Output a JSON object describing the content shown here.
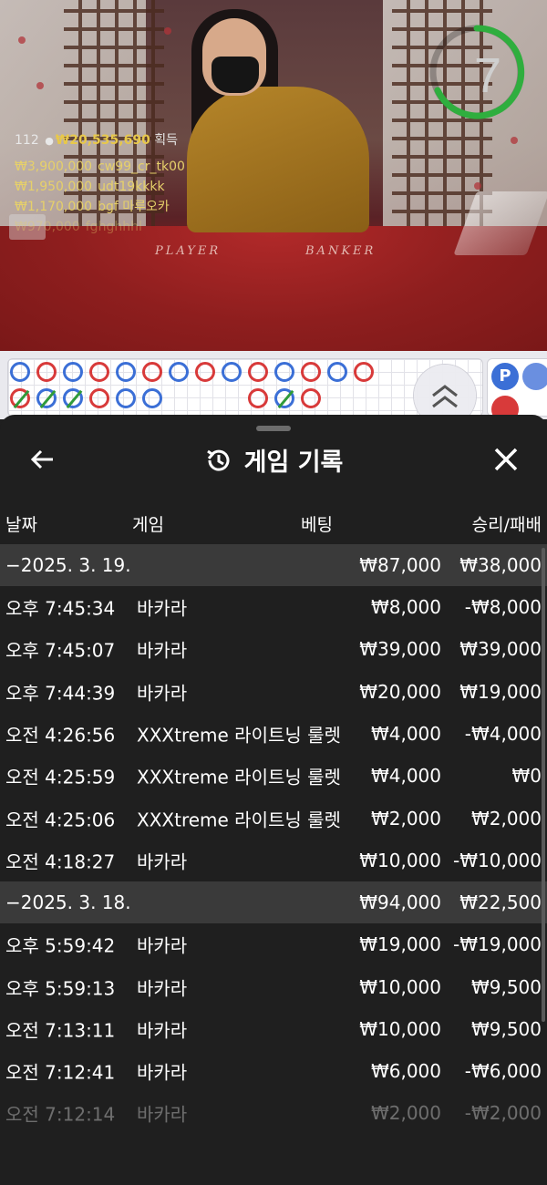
{
  "video": {
    "timer": "7",
    "felt_left": "PLAYER",
    "felt_right": "BANKER",
    "players": "112",
    "win_total": "₩20,535,690",
    "win_label": "획득",
    "winners": [
      {
        "amount": "₩3,900,000",
        "user": "cw99_cr_tk00"
      },
      {
        "amount": "₩1,950,000",
        "user": "udt19kkkk"
      },
      {
        "amount": "₩1,170,000",
        "user": "bgf 마루오카"
      },
      {
        "amount": "₩970,000",
        "user": "fghghhhl"
      }
    ]
  },
  "roads": {
    "side_label": "P",
    "collapse_icon": "chevron-up-double-icon"
  },
  "sheet": {
    "title": "게임 기록",
    "back_icon": "arrow-left-icon",
    "close_icon": "close-icon",
    "history_icon": "history-icon",
    "columns": {
      "date": "날짜",
      "game": "게임",
      "bet": "베팅",
      "result": "승리/패배"
    },
    "groups": [
      {
        "date": "−2025. 3. 19.",
        "bet": "₩87,000",
        "result": "₩38,000",
        "rows": [
          {
            "time": "오후 7:45:34",
            "game": "바카라",
            "bet": "₩8,000",
            "result": "-₩8,000"
          },
          {
            "time": "오후 7:45:07",
            "game": "바카라",
            "bet": "₩39,000",
            "result": "₩39,000"
          },
          {
            "time": "오후 7:44:39",
            "game": "바카라",
            "bet": "₩20,000",
            "result": "₩19,000"
          },
          {
            "time": "오전 4:26:56",
            "game": "XXXtreme 라이트닝 룰렛",
            "bet": "₩4,000",
            "result": "-₩4,000"
          },
          {
            "time": "오전 4:25:59",
            "game": "XXXtreme 라이트닝 룰렛",
            "bet": "₩4,000",
            "result": "₩0"
          },
          {
            "time": "오전 4:25:06",
            "game": "XXXtreme 라이트닝 룰렛",
            "bet": "₩2,000",
            "result": "₩2,000"
          },
          {
            "time": "오전 4:18:27",
            "game": "바카라",
            "bet": "₩10,000",
            "result": "-₩10,000"
          }
        ]
      },
      {
        "date": "−2025. 3. 18.",
        "bet": "₩94,000",
        "result": "₩22,500",
        "rows": [
          {
            "time": "오후 5:59:42",
            "game": "바카라",
            "bet": "₩19,000",
            "result": "-₩19,000"
          },
          {
            "time": "오후 5:59:13",
            "game": "바카라",
            "bet": "₩10,000",
            "result": "₩9,500"
          },
          {
            "time": "오전 7:13:11",
            "game": "바카라",
            "bet": "₩10,000",
            "result": "₩9,500"
          },
          {
            "time": "오전 7:12:41",
            "game": "바카라",
            "bet": "₩6,000",
            "result": "-₩6,000"
          },
          {
            "time": "오전 7:12:14",
            "game": "바카라",
            "bet": "₩2,000",
            "result": "-₩2,000"
          }
        ]
      }
    ]
  }
}
